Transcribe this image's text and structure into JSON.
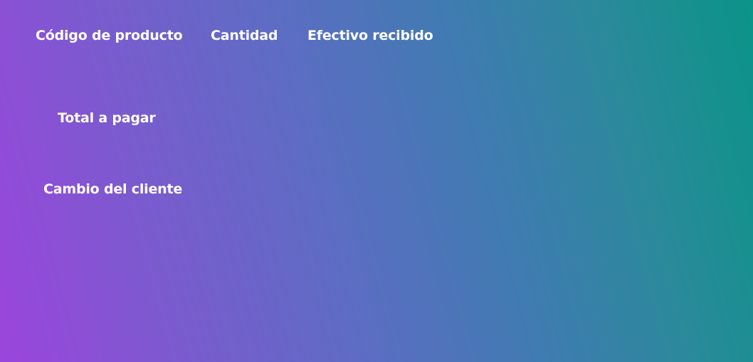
{
  "colors": {
    "gradient_start": "#9b45dc",
    "gradient_end": "#0a9488",
    "text": "#ffffff"
  },
  "form": {
    "product_code_label": "Código de producto",
    "quantity_label": "Cantidad",
    "cash_received_label": "Efectivo recibido",
    "total_label": "Total a pagar",
    "change_label": "Cambio del cliente"
  }
}
